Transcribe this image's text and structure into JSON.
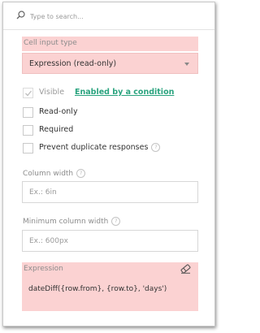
{
  "search": {
    "placeholder": "Type to search...",
    "icon": "search-icon"
  },
  "cell_input_type": {
    "label": "Cell input type",
    "selected": "Expression (read-only)"
  },
  "checkboxes": {
    "visible": {
      "label": "Visible",
      "checked": true,
      "disabled": true,
      "link": "Enabled by a condition"
    },
    "read_only": {
      "label": "Read-only",
      "checked": false
    },
    "required": {
      "label": "Required",
      "checked": false
    },
    "prevent_duplicates": {
      "label": "Prevent duplicate responses",
      "checked": false
    }
  },
  "column_width": {
    "label": "Column width",
    "placeholder": "Ex.: 6in",
    "value": ""
  },
  "min_column_width": {
    "label": "Minimum column width",
    "placeholder": "Ex.: 600px",
    "value": ""
  },
  "expression": {
    "label": "Expression",
    "value": "dateDiff({row.from}, {row.to}, 'days')"
  },
  "colors": {
    "highlight": "#fbd2d2",
    "link": "#29a37e",
    "label": "#8c8c8c"
  }
}
